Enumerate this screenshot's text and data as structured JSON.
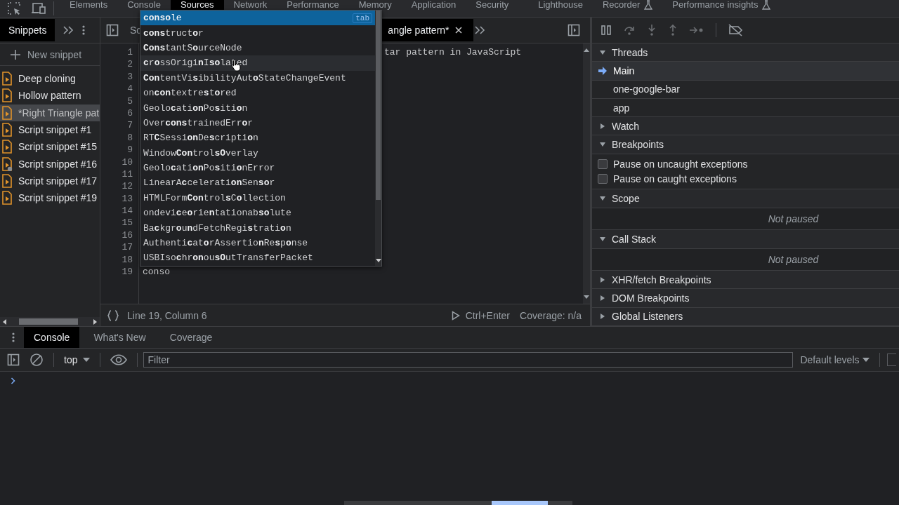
{
  "main_tabs": [
    {
      "label": "Elements",
      "selected": false,
      "experimental": false
    },
    {
      "label": "Console",
      "selected": false,
      "experimental": false
    },
    {
      "label": "Sources",
      "selected": true,
      "experimental": false
    },
    {
      "label": "Network",
      "selected": false,
      "experimental": false
    },
    {
      "label": "Performance",
      "selected": false,
      "experimental": false
    },
    {
      "label": "Memory",
      "selected": false,
      "experimental": false
    },
    {
      "label": "Application",
      "selected": false,
      "experimental": false
    },
    {
      "label": "Security",
      "selected": false,
      "experimental": false
    },
    {
      "label": "Lighthouse",
      "selected": false,
      "experimental": false
    },
    {
      "label": "Recorder",
      "selected": false,
      "experimental": true
    },
    {
      "label": "Performance insights",
      "selected": false,
      "experimental": true
    }
  ],
  "navigator": {
    "tabs": [
      {
        "label": "Snippets",
        "selected": true
      }
    ],
    "new_snippet": "New snippet",
    "snippets": [
      {
        "name": "Deep cloning",
        "selected": false,
        "marked": false
      },
      {
        "name": "Hollow pattern",
        "selected": false,
        "marked": false
      },
      {
        "name": "*Right Triangle pat",
        "selected": true,
        "marked": false
      },
      {
        "name": "Script snippet #1",
        "selected": false,
        "marked": false
      },
      {
        "name": "Script snippet #15",
        "selected": false,
        "marked": false
      },
      {
        "name": "Script snippet #16",
        "selected": false,
        "marked": true
      },
      {
        "name": "Script snippet #17",
        "selected": false,
        "marked": false
      },
      {
        "name": "Script snippet #19",
        "selected": false,
        "marked": false
      }
    ]
  },
  "editor": {
    "tabs": [
      {
        "label": "Sc",
        "selected": false,
        "closable": false
      },
      {
        "label": "angle pattern*",
        "selected": true,
        "closable": true
      }
    ],
    "lines": [
      {
        "number": "1",
        "code": "tar pattern in JavaScript"
      },
      {
        "number": "2"
      },
      {
        "number": "3"
      },
      {
        "number": "4"
      },
      {
        "number": "5"
      },
      {
        "number": "6"
      },
      {
        "number": "7"
      },
      {
        "number": "8"
      },
      {
        "number": "9"
      },
      {
        "number": "10"
      },
      {
        "number": "11"
      },
      {
        "number": "12"
      },
      {
        "number": "13"
      },
      {
        "number": "14"
      },
      {
        "number": "15"
      },
      {
        "number": "16"
      },
      {
        "number": "17"
      },
      {
        "number": "18"
      },
      {
        "number": "19",
        "code": "conso"
      }
    ],
    "status": {
      "position": "Line 19, Column 6",
      "run_shortcut": "Ctrl+Enter",
      "coverage": "Coverage: n/a"
    }
  },
  "autocomplete": {
    "hint": "tab",
    "items": [
      {
        "text": "**conso**le",
        "selected": true,
        "hovered": false
      },
      {
        "text": "**cons**truct**o**r",
        "selected": false,
        "hovered": false
      },
      {
        "text": "**Cons**tantS**o**urceNode",
        "selected": false,
        "hovered": false
      },
      {
        "text": "**c**r**o**ssOrigi**n**I**so**lated",
        "selected": false,
        "hovered": true
      },
      {
        "text": "**Con**tentVi**s**ibilityAut**o**StateChangeEvent",
        "selected": false,
        "hovered": false
      },
      {
        "text": "on**con**textre**s**t**o**red",
        "selected": false,
        "hovered": false
      },
      {
        "text": "Geolo**c**ati**on**Po**s**iti**o**n",
        "selected": false,
        "hovered": false
      },
      {
        "text": "Over**cons**trainedErr**o**r",
        "selected": false,
        "hovered": false
      },
      {
        "text": "RT**C**Sessi**on**De**s**cripti**o**n",
        "selected": false,
        "hovered": false
      },
      {
        "text": "Window**Con**trol**sO**verlay",
        "selected": false,
        "hovered": false
      },
      {
        "text": "Geolo**c**ati**on**Po**s**iti**o**nError",
        "selected": false,
        "hovered": false
      },
      {
        "text": "LinearA**c**celerati**on**Sen**so**r",
        "selected": false,
        "hovered": false
      },
      {
        "text": "HTMLForm**Con**trol**s**C**o**llection",
        "selected": false,
        "hovered": false
      },
      {
        "text": "ondevi**c**e**o**rie**n**tationab**so**lute",
        "selected": false,
        "hovered": false
      },
      {
        "text": "Ba**c**kgr**o**u**n**dFetchRegi**s**trati**o**n",
        "selected": false,
        "hovered": false
      },
      {
        "text": "Authenti**c**at**o**rAssertio**n**Re**s**p**o**nse",
        "selected": false,
        "hovered": false
      },
      {
        "text": "USBIso**c**hr**on**ou**sO**utTransferPacket",
        "selected": false,
        "hovered": false
      }
    ]
  },
  "debugger": {
    "rows": [
      {
        "kind": "section",
        "label": "Threads",
        "expanded": true
      },
      {
        "kind": "thread",
        "label": "Main",
        "selected": true
      },
      {
        "kind": "thread",
        "label": "one-google-bar",
        "selected": false
      },
      {
        "kind": "thread",
        "label": "app",
        "selected": false
      },
      {
        "kind": "section",
        "label": "Watch",
        "expanded": false
      },
      {
        "kind": "section",
        "label": "Breakpoints",
        "expanded": true
      },
      {
        "kind": "checkbox",
        "label": "Pause on uncaught exceptions",
        "checked": false
      },
      {
        "kind": "checkbox",
        "label": "Pause on caught exceptions",
        "checked": false
      },
      {
        "kind": "section",
        "label": "Scope",
        "expanded": true
      },
      {
        "kind": "message",
        "text": "Not paused"
      },
      {
        "kind": "section",
        "label": "Call Stack",
        "expanded": true
      },
      {
        "kind": "message",
        "text": "Not paused"
      },
      {
        "kind": "section",
        "label": "XHR/fetch Breakpoints",
        "expanded": false
      },
      {
        "kind": "section",
        "label": "DOM Breakpoints",
        "expanded": false
      },
      {
        "kind": "section",
        "label": "Global Listeners",
        "expanded": false
      }
    ]
  },
  "drawer": {
    "tabs": [
      {
        "label": "Console",
        "selected": true
      },
      {
        "label": "What's New",
        "selected": false
      },
      {
        "label": "Coverage",
        "selected": false
      }
    ],
    "context": "top",
    "filter": {
      "placeholder": "Filter"
    },
    "levels": "Default levels"
  }
}
